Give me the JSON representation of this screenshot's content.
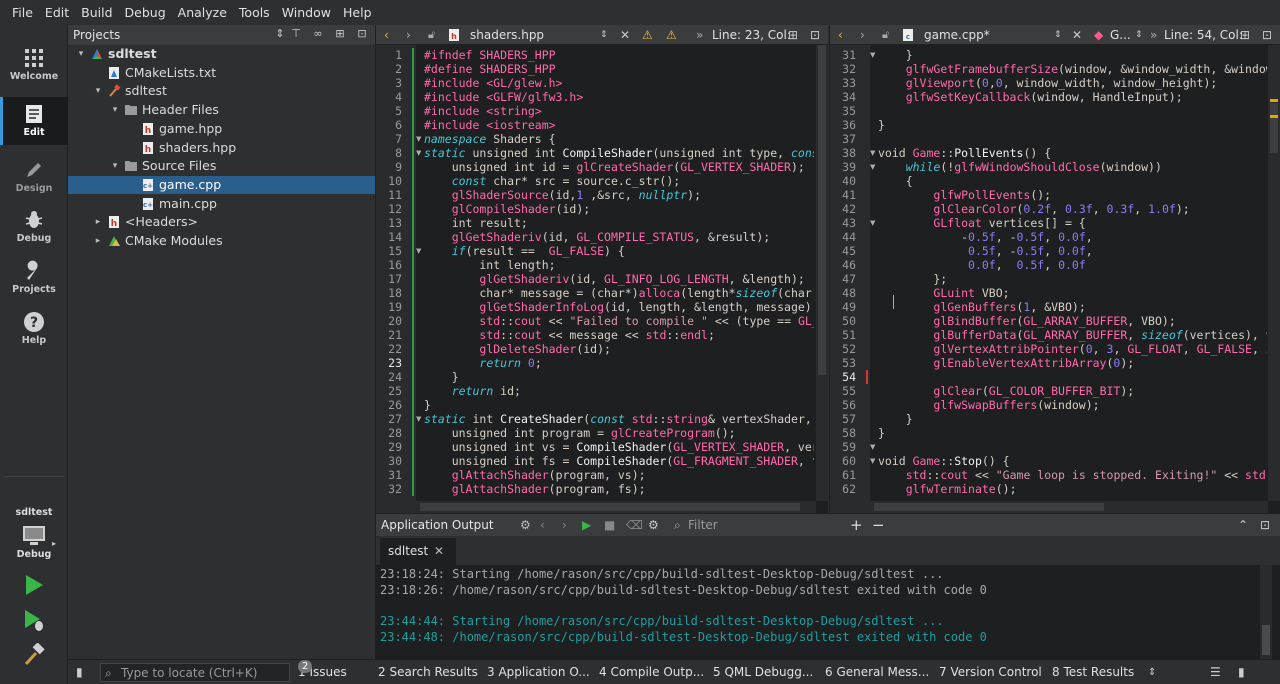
{
  "menu": [
    "File",
    "Edit",
    "Build",
    "Debug",
    "Analyze",
    "Tools",
    "Window",
    "Help"
  ],
  "modes": [
    {
      "label": "Welcome",
      "icon": "welcome-grid-icon"
    },
    {
      "label": "Edit",
      "icon": "edit-document-icon"
    },
    {
      "label": "Design",
      "icon": "design-pencil-icon"
    },
    {
      "label": "Debug",
      "icon": "debug-bug-icon"
    },
    {
      "label": "Projects",
      "icon": "projects-wrench-icon"
    },
    {
      "label": "Help",
      "icon": "help-question-icon"
    }
  ],
  "kit": {
    "project": "sdltest",
    "mode": "Debug"
  },
  "projects": {
    "title": "Projects",
    "tree": [
      {
        "label": "sdltest",
        "depth": 0,
        "arrow": "▾",
        "icon": "cmake-project-icon",
        "bold": true
      },
      {
        "label": "CMakeLists.txt",
        "depth": 1,
        "arrow": "",
        "icon": "cmake-file-icon"
      },
      {
        "label": "sdltest",
        "depth": 1,
        "arrow": "▾",
        "icon": "target-hammer-icon"
      },
      {
        "label": "Header Files",
        "depth": 2,
        "arrow": "▾",
        "icon": "folder-icon"
      },
      {
        "label": "game.hpp",
        "depth": 3,
        "arrow": "",
        "icon": "header-file-icon"
      },
      {
        "label": "shaders.hpp",
        "depth": 3,
        "arrow": "",
        "icon": "header-file-icon"
      },
      {
        "label": "Source Files",
        "depth": 2,
        "arrow": "▾",
        "icon": "folder-icon"
      },
      {
        "label": "game.cpp",
        "depth": 3,
        "arrow": "",
        "icon": "cpp-file-icon",
        "selected": true
      },
      {
        "label": "main.cpp",
        "depth": 3,
        "arrow": "",
        "icon": "cpp-file-icon"
      },
      {
        "label": "<Headers>",
        "depth": 1,
        "arrow": "▸",
        "icon": "header-file-icon"
      },
      {
        "label": "CMake Modules",
        "depth": 1,
        "arrow": "▸",
        "icon": "cmake-modules-icon"
      }
    ]
  },
  "editor_left": {
    "file": "shaders.hpp",
    "position": "Line: 23, Col:",
    "first_line": 1,
    "current_line": 23,
    "lines": [
      [
        [
          "pp",
          "#ifndef SHADERS_HPP"
        ]
      ],
      [
        [
          "pp",
          "#define SHADERS_HPP"
        ]
      ],
      [
        [
          "pp",
          "#include <GL/glew.h>"
        ]
      ],
      [
        [
          "pp",
          "#include <GLFW/glfw3.h>"
        ]
      ],
      [
        [
          "pp",
          "#include <string>"
        ]
      ],
      [
        [
          "pp",
          "#include <iostream>"
        ]
      ],
      [
        [
          "kw",
          "namespace"
        ],
        [
          "ty",
          " Shaders {"
        ]
      ],
      [
        [
          "kw",
          "static"
        ],
        [
          "ty",
          " unsigned int "
        ],
        [
          "fn",
          "CompileShader"
        ],
        [
          "ty",
          "(unsigned int type, "
        ],
        [
          "kw",
          "cons"
        ]
      ],
      [
        [
          "ty",
          "    unsigned int id = "
        ],
        [
          "mc",
          "glCreateShader"
        ],
        [
          "ty",
          "("
        ],
        [
          "mc",
          "GL_VERTEX_SHADER"
        ],
        [
          "ty",
          ");"
        ]
      ],
      [
        [
          "ty",
          "    "
        ],
        [
          "kw",
          "const"
        ],
        [
          "ty",
          " char* src = source.c_str();"
        ]
      ],
      [
        [
          "ty",
          "    "
        ],
        [
          "mc",
          "glShaderSource"
        ],
        [
          "ty",
          "(id,"
        ],
        [
          "nm",
          "1"
        ],
        [
          "ty",
          " ,&src, "
        ],
        [
          "kw",
          "nullptr"
        ],
        [
          "ty",
          ");"
        ]
      ],
      [
        [
          "ty",
          "    "
        ],
        [
          "mc",
          "glCompileShader"
        ],
        [
          "ty",
          "(id);"
        ]
      ],
      [
        [
          "ty",
          "    int result;"
        ]
      ],
      [
        [
          "ty",
          "    "
        ],
        [
          "mc",
          "glGetShaderiv"
        ],
        [
          "ty",
          "(id, "
        ],
        [
          "mc",
          "GL_COMPILE_STATUS"
        ],
        [
          "ty",
          ", &result);"
        ]
      ],
      [
        [
          "ty",
          "    "
        ],
        [
          "kw",
          "if"
        ],
        [
          "ty",
          "(result ==  "
        ],
        [
          "mc",
          "GL_FALSE"
        ],
        [
          "ty",
          ") {"
        ]
      ],
      [
        [
          "ty",
          "        int length;"
        ]
      ],
      [
        [
          "ty",
          "        "
        ],
        [
          "mc",
          "glGetShaderiv"
        ],
        [
          "ty",
          "(id, "
        ],
        [
          "mc",
          "GL_INFO_LOG_LENGTH"
        ],
        [
          "ty",
          ", &length);"
        ]
      ],
      [
        [
          "ty",
          "        char* message = (char*)"
        ],
        [
          "mc",
          "alloca"
        ],
        [
          "ty",
          "(length*"
        ],
        [
          "kw",
          "sizeof"
        ],
        [
          "ty",
          "(char)"
        ]
      ],
      [
        [
          "ty",
          "        "
        ],
        [
          "mc",
          "glGetShaderInfoLog"
        ],
        [
          "ty",
          "(id, length, &length, message);"
        ]
      ],
      [
        [
          "ty",
          "        "
        ],
        [
          "mc",
          "std"
        ],
        [
          "ty",
          "::"
        ],
        [
          "mc",
          "cout"
        ],
        [
          "ty",
          " << "
        ],
        [
          "st",
          "\"Failed to compile \""
        ],
        [
          "ty",
          " << (type == "
        ],
        [
          "mc",
          "GL_V"
        ]
      ],
      [
        [
          "ty",
          "        "
        ],
        [
          "mc",
          "std"
        ],
        [
          "ty",
          "::"
        ],
        [
          "mc",
          "cout"
        ],
        [
          "ty",
          " << message << "
        ],
        [
          "mc",
          "std"
        ],
        [
          "ty",
          "::"
        ],
        [
          "mc",
          "endl"
        ],
        [
          "ty",
          ";"
        ]
      ],
      [
        [
          "ty",
          "        "
        ],
        [
          "mc",
          "glDeleteShader"
        ],
        [
          "ty",
          "(id);"
        ]
      ],
      [
        [
          "ty",
          "        "
        ],
        [
          "kw",
          "return"
        ],
        [
          "ty",
          " "
        ],
        [
          "nm",
          "0"
        ],
        [
          "ty",
          ";"
        ]
      ],
      [
        [
          "ty",
          "    }"
        ]
      ],
      [
        [
          "ty",
          "    "
        ],
        [
          "kw",
          "return"
        ],
        [
          "ty",
          " id;"
        ]
      ],
      [
        [
          "ty",
          "}"
        ]
      ],
      [
        [
          "kw",
          "static"
        ],
        [
          "ty",
          " int "
        ],
        [
          "fn",
          "CreateShader"
        ],
        [
          "ty",
          "("
        ],
        [
          "kw",
          "const"
        ],
        [
          "ty",
          " "
        ],
        [
          "mc",
          "std"
        ],
        [
          "ty",
          "::"
        ],
        [
          "mc",
          "string"
        ],
        [
          "ty",
          "& vertexShader, "
        ]
      ],
      [
        [
          "ty",
          "    unsigned int program = "
        ],
        [
          "mc",
          "glCreateProgram"
        ],
        [
          "ty",
          "();"
        ]
      ],
      [
        [
          "ty",
          "    unsigned int vs = "
        ],
        [
          "fn",
          "CompileShader"
        ],
        [
          "ty",
          "("
        ],
        [
          "mc",
          "GL_VERTEX_SHADER"
        ],
        [
          "ty",
          ", vert"
        ]
      ],
      [
        [
          "ty",
          "    unsigned int fs = "
        ],
        [
          "fn",
          "CompileShader"
        ],
        [
          "ty",
          "("
        ],
        [
          "mc",
          "GL_FRAGMENT_SHADER"
        ],
        [
          "ty",
          ", fr"
        ]
      ],
      [
        [
          "ty",
          "    "
        ],
        [
          "mc",
          "glAttachShader"
        ],
        [
          "ty",
          "(program, vs);"
        ]
      ],
      [
        [
          "ty",
          "    "
        ],
        [
          "mc",
          "glAttachShader"
        ],
        [
          "ty",
          "(program, fs);"
        ]
      ]
    ]
  },
  "editor_right": {
    "file": "game.cpp*",
    "symbol": "G...",
    "position": "Line: 54, Col:",
    "first_line": 31,
    "current_line": 54,
    "lines": [
      [
        [
          "ty",
          "    }"
        ]
      ],
      [
        [
          "ty",
          "    "
        ],
        [
          "mc",
          "glfwGetFramebufferSize"
        ],
        [
          "ty",
          "(window, &window_width, &window_"
        ]
      ],
      [
        [
          "ty",
          "    "
        ],
        [
          "mc",
          "glViewport"
        ],
        [
          "ty",
          "("
        ],
        [
          "nm",
          "0"
        ],
        [
          "ty",
          ","
        ],
        [
          "nm",
          "0"
        ],
        [
          "ty",
          ", window_width, window_height);"
        ]
      ],
      [
        [
          "ty",
          "    "
        ],
        [
          "mc",
          "glfwSetKeyCallback"
        ],
        [
          "ty",
          "(window, HandleInput);"
        ]
      ],
      [
        [
          "ty",
          ""
        ]
      ],
      [
        [
          "ty",
          "}"
        ]
      ],
      [
        [
          "ty",
          ""
        ]
      ],
      [
        [
          "ty",
          "void "
        ],
        [
          "mc",
          "Game"
        ],
        [
          "ty",
          "::"
        ],
        [
          "fn",
          "PollEvents"
        ],
        [
          "ty",
          "() {"
        ]
      ],
      [
        [
          "ty",
          "    "
        ],
        [
          "kw",
          "while"
        ],
        [
          "ty",
          "(!"
        ],
        [
          "mc",
          "glfwWindowShouldClose"
        ],
        [
          "ty",
          "(window))"
        ]
      ],
      [
        [
          "ty",
          "    {"
        ]
      ],
      [
        [
          "ty",
          "        "
        ],
        [
          "mc",
          "glfwPollEvents"
        ],
        [
          "ty",
          "();"
        ]
      ],
      [
        [
          "ty",
          "        "
        ],
        [
          "mc",
          "glClearColor"
        ],
        [
          "ty",
          "("
        ],
        [
          "nm",
          "0.2f"
        ],
        [
          "ty",
          ", "
        ],
        [
          "nm",
          "0.3f"
        ],
        [
          "ty",
          ", "
        ],
        [
          "nm",
          "0.3f"
        ],
        [
          "ty",
          ", "
        ],
        [
          "nm",
          "1.0f"
        ],
        [
          "ty",
          ");"
        ]
      ],
      [
        [
          "ty",
          "        "
        ],
        [
          "mc",
          "GLfloat"
        ],
        [
          "ty",
          " vertices[] = {"
        ]
      ],
      [
        [
          "ty",
          "            -"
        ],
        [
          "nm",
          "0.5f"
        ],
        [
          "ty",
          ", -"
        ],
        [
          "nm",
          "0.5f"
        ],
        [
          "ty",
          ", "
        ],
        [
          "nm",
          "0.0f"
        ],
        [
          "ty",
          ","
        ]
      ],
      [
        [
          "ty",
          "             "
        ],
        [
          "nm",
          "0.5f"
        ],
        [
          "ty",
          ", -"
        ],
        [
          "nm",
          "0.5f"
        ],
        [
          "ty",
          ", "
        ],
        [
          "nm",
          "0.0f"
        ],
        [
          "ty",
          ","
        ]
      ],
      [
        [
          "ty",
          "             "
        ],
        [
          "nm",
          "0.0f"
        ],
        [
          "ty",
          ",  "
        ],
        [
          "nm",
          "0.5f"
        ],
        [
          "ty",
          ", "
        ],
        [
          "nm",
          "0.0f"
        ]
      ],
      [
        [
          "ty",
          "        };"
        ]
      ],
      [
        [
          "ty",
          "        "
        ],
        [
          "mc",
          "GLuint"
        ],
        [
          "ty",
          " VBO;"
        ]
      ],
      [
        [
          "ty",
          "        "
        ],
        [
          "mc",
          "glGenBuffers"
        ],
        [
          "ty",
          "("
        ],
        [
          "nm",
          "1"
        ],
        [
          "ty",
          ", &VBO);"
        ]
      ],
      [
        [
          "ty",
          "        "
        ],
        [
          "mc",
          "glBindBuffer"
        ],
        [
          "ty",
          "("
        ],
        [
          "mc",
          "GL_ARRAY_BUFFER"
        ],
        [
          "ty",
          ", VBO);"
        ]
      ],
      [
        [
          "ty",
          "        "
        ],
        [
          "mc",
          "glBufferData"
        ],
        [
          "ty",
          "("
        ],
        [
          "mc",
          "GL_ARRAY_BUFFER"
        ],
        [
          "ty",
          ", "
        ],
        [
          "kw",
          "sizeof"
        ],
        [
          "ty",
          "(vertices), v"
        ]
      ],
      [
        [
          "ty",
          "        "
        ],
        [
          "mc",
          "glVertexAttribPointer"
        ],
        [
          "ty",
          "("
        ],
        [
          "nm",
          "0"
        ],
        [
          "ty",
          ", "
        ],
        [
          "nm",
          "3"
        ],
        [
          "ty",
          ", "
        ],
        [
          "mc",
          "GL_FLOAT"
        ],
        [
          "ty",
          ", "
        ],
        [
          "mc",
          "GL_FALSE"
        ],
        [
          "ty",
          ", "
        ],
        [
          "nm",
          "3"
        ]
      ],
      [
        [
          "ty",
          "        "
        ],
        [
          "mc",
          "glEnableVertexAttribArray"
        ],
        [
          "ty",
          "("
        ],
        [
          "nm",
          "0"
        ],
        [
          "ty",
          ");"
        ]
      ],
      [
        [
          "ty",
          ""
        ]
      ],
      [
        [
          "ty",
          "        "
        ],
        [
          "mc",
          "glClear"
        ],
        [
          "ty",
          "("
        ],
        [
          "mc",
          "GL_COLOR_BUFFER_BIT"
        ],
        [
          "ty",
          ");"
        ]
      ],
      [
        [
          "ty",
          "        "
        ],
        [
          "mc",
          "glfwSwapBuffers"
        ],
        [
          "ty",
          "(window);"
        ]
      ],
      [
        [
          "ty",
          "    }"
        ]
      ],
      [
        [
          "ty",
          "}"
        ]
      ],
      [
        [
          "ty",
          ""
        ]
      ],
      [
        [
          "ty",
          "void "
        ],
        [
          "mc",
          "Game"
        ],
        [
          "ty",
          "::"
        ],
        [
          "fn",
          "Stop"
        ],
        [
          "ty",
          "() {"
        ]
      ],
      [
        [
          "ty",
          "    "
        ],
        [
          "mc",
          "std"
        ],
        [
          "ty",
          "::"
        ],
        [
          "mc",
          "cout"
        ],
        [
          "ty",
          " << "
        ],
        [
          "st",
          "\"Game loop is stopped. Exiting!\""
        ],
        [
          "ty",
          " << "
        ],
        [
          "mc",
          "std"
        ],
        [
          "ty",
          ":"
        ]
      ],
      [
        [
          "ty",
          "    "
        ],
        [
          "mc",
          "glfwTerminate"
        ],
        [
          "ty",
          "();"
        ]
      ]
    ]
  },
  "output": {
    "title": "Application Output",
    "filter_placeholder": "Filter",
    "tab": "sdltest",
    "lines": [
      {
        "text": "23:18:24: Starting /home/rason/src/cpp/build-sdltest-Desktop-Debug/sdltest ...",
        "color": "#a8a8a8"
      },
      {
        "text": "23:18:26: /home/rason/src/cpp/build-sdltest-Desktop-Debug/sdltest exited with code 0",
        "color": "#a8a8a8"
      },
      {
        "text": "",
        "color": "#a8a8a8"
      },
      {
        "text": "23:44:44: Starting /home/rason/src/cpp/build-sdltest-Desktop-Debug/sdltest ...",
        "color": "#1f9ea0"
      },
      {
        "text": "23:44:48: /home/rason/src/cpp/build-sdltest-Desktop-Debug/sdltest exited with code 0",
        "color": "#1f9ea0"
      }
    ]
  },
  "status": {
    "locator_placeholder": "Type to locate (Ctrl+K)",
    "panes": [
      {
        "label": "1  Issues",
        "badge": "2"
      },
      {
        "label": "2  Search Results"
      },
      {
        "label": "3  Application O..."
      },
      {
        "label": "4  Compile Outp..."
      },
      {
        "label": "5  QML Debugg..."
      },
      {
        "label": "6  General Mess..."
      },
      {
        "label": "7  Version Control"
      },
      {
        "label": "8  Test Results"
      }
    ]
  },
  "colors": {
    "accent": "#3a9ad9",
    "selection": "#2a5e8c",
    "run_green": "#3ab54a",
    "keyword": "#45c6d6",
    "macro": "#ff6aad",
    "number": "#8a7cf2"
  }
}
